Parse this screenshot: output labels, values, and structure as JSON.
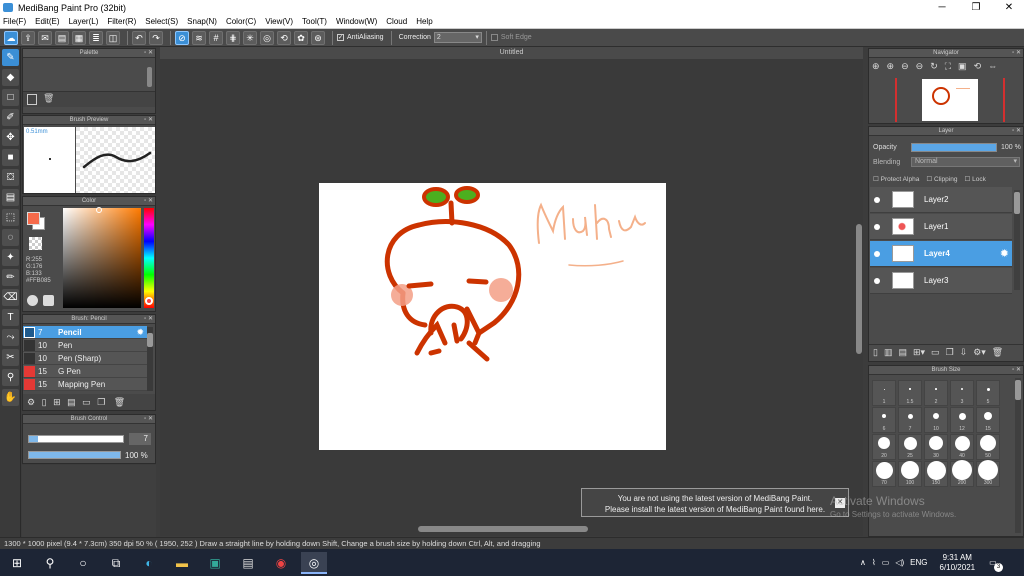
{
  "window": {
    "title": "MediBang Paint Pro (32bit)"
  },
  "menu": [
    "File(F)",
    "Edit(E)",
    "Layer(L)",
    "Filter(R)",
    "Select(S)",
    "Snap(N)",
    "Color(C)",
    "View(V)",
    "Tool(T)",
    "Window(W)",
    "Cloud",
    "Help"
  ],
  "toolbar": {
    "antialias_label": "AntiAliasing",
    "correction_label": "Correction",
    "correction_value": "2",
    "soft_edge_label": "Soft Edge"
  },
  "panels": {
    "palette": "Palette",
    "brush_preview": "Brush Preview",
    "brush_preview_size": "0.51mm",
    "color": "Color",
    "color_values": {
      "r": "R:255",
      "g": "G:176",
      "b": "B:133",
      "hex": "#FFB085"
    },
    "brush_panel": "Brush: Pencil",
    "brush_control": "Brush Control",
    "brush_control_size": "7",
    "brush_control_opacity": "100 %",
    "navigator": "Navigator",
    "layer": "Layer",
    "brush_size": "Brush Size"
  },
  "brushes": [
    {
      "size": "7",
      "name": "Pencil",
      "color": "#3b8fd6",
      "selected": true
    },
    {
      "size": "10",
      "name": "Pen",
      "color": "#333333",
      "selected": false
    },
    {
      "size": "10",
      "name": "Pen (Sharp)",
      "color": "#333333",
      "selected": false
    },
    {
      "size": "15",
      "name": "G Pen",
      "color": "#e53935",
      "selected": false
    },
    {
      "size": "15",
      "name": "Mapping Pen",
      "color": "#e53935",
      "selected": false
    }
  ],
  "layers_panel": {
    "opacity_label": "Opacity",
    "opacity_value": "100 %",
    "opacity_fraction": 1.0,
    "blending_label": "Blending",
    "blending_value": "Normal",
    "protect_alpha": "Protect Alpha",
    "clipping": "Clipping",
    "lock": "Lock",
    "layers": [
      {
        "name": "Layer2",
        "selected": false
      },
      {
        "name": "Layer1",
        "selected": false
      },
      {
        "name": "Layer4",
        "selected": true
      },
      {
        "name": "Layer3",
        "selected": false
      }
    ]
  },
  "brush_size_labels": [
    "1",
    "1.5",
    "2",
    "3",
    "5",
    "6",
    "7",
    "10",
    "12",
    "15",
    "20",
    "25",
    "30",
    "40",
    "50",
    "70",
    "100",
    "150",
    "200",
    "300"
  ],
  "canvas": {
    "title": "Untitled"
  },
  "notice": {
    "line1": "You are not using the latest version of MediBang Paint.",
    "line2": "Please install the latest version of MediBang Paint found here."
  },
  "watermark": {
    "line1": "Activate Windows",
    "line2": "Go to Settings to activate Windows."
  },
  "status": "1300 * 1000 pixel   (9.4 * 7.3cm)   350 dpi   50 %   ( 1950, 252 )   Draw a straight line by holding down Shift, Change a brush size by holding down Ctrl, Alt, and dragging",
  "taskbar": {
    "lang": "ENG",
    "time": "9:31 AM",
    "date": "6/10/2021",
    "notif_count": "3"
  },
  "colors": {
    "accent": "#3b8fd6",
    "stroke_red": "#cc3300",
    "stroke_peach": "#f4b08a",
    "sprout_green": "#4caf1f"
  }
}
